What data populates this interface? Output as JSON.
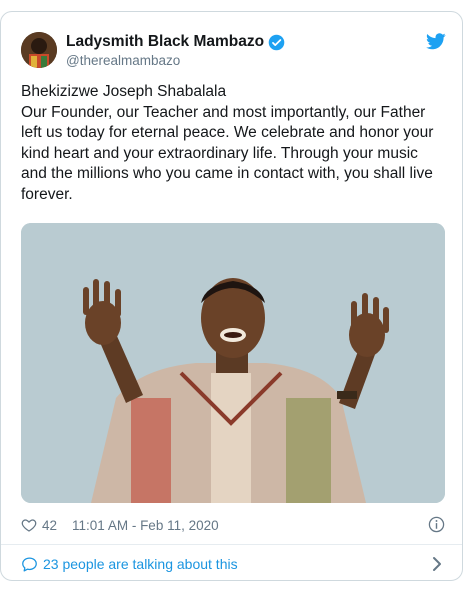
{
  "tweet": {
    "author": {
      "display_name": "Ladysmith Black Mambazo",
      "handle": "@therealmambazo",
      "verified": true
    },
    "text_lines": [
      "Bhekizizwe Joseph Shabalala",
      "Our Founder, our Teacher and most importantly, our Father left us today for eternal peace. We celebrate and honor your kind heart and your extraordinary life. Through your music and the millions who you came in contact with, you shall live forever."
    ],
    "likes": "42",
    "timestamp": "11:01 AM - Feb 11, 2020",
    "conversation_label": "23 people are talking about this"
  },
  "colors": {
    "accent": "#1b95e0",
    "muted": "#657786",
    "border": "#cfd9de"
  },
  "icons": [
    "twitter-bird-icon",
    "verified-badge-icon",
    "heart-icon",
    "info-icon",
    "comment-bubble-icon",
    "chevron-right-icon"
  ]
}
